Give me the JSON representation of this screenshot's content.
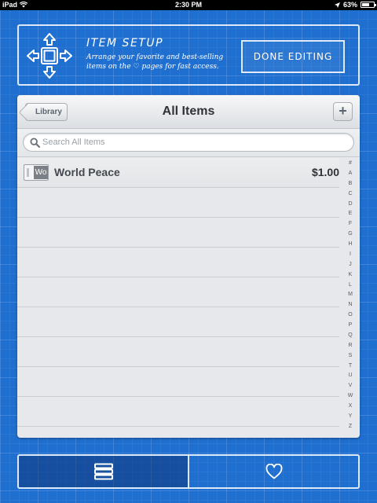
{
  "status_bar": {
    "device": "iPad",
    "time": "2:30 PM",
    "battery": "63%",
    "battery_level": 0.63
  },
  "setup_banner": {
    "title": "ITEM SETUP",
    "description_line1": "Arrange your favorite and best-selling",
    "description_line2_before": "items on the ",
    "description_heart": "♡",
    "description_line2_after": " pages for fast access.",
    "done_label": "DONE EDITING",
    "icon": "move-arrows-icon"
  },
  "panel": {
    "back_label": "Library",
    "title": "All Items",
    "add_label": "+",
    "search": {
      "placeholder": "Search All Items",
      "value": ""
    },
    "items": [
      {
        "thumb": "Wo",
        "name": "World Peace",
        "price": "$1.00"
      }
    ],
    "index_letters": [
      "#",
      "A",
      "B",
      "C",
      "D",
      "E",
      "F",
      "G",
      "H",
      "I",
      "J",
      "K",
      "L",
      "M",
      "N",
      "O",
      "P",
      "Q",
      "R",
      "S",
      "T",
      "U",
      "V",
      "W",
      "X",
      "Y",
      "Z"
    ]
  },
  "tabs": [
    {
      "name": "list",
      "icon": "stack-list-icon",
      "active": true
    },
    {
      "name": "favorites",
      "icon": "heart-icon",
      "active": false
    }
  ],
  "colors": {
    "blueprint_bg": "#1f6fd0",
    "panel_bg": "#e6e8eb",
    "accent_white": "#ffffff"
  }
}
